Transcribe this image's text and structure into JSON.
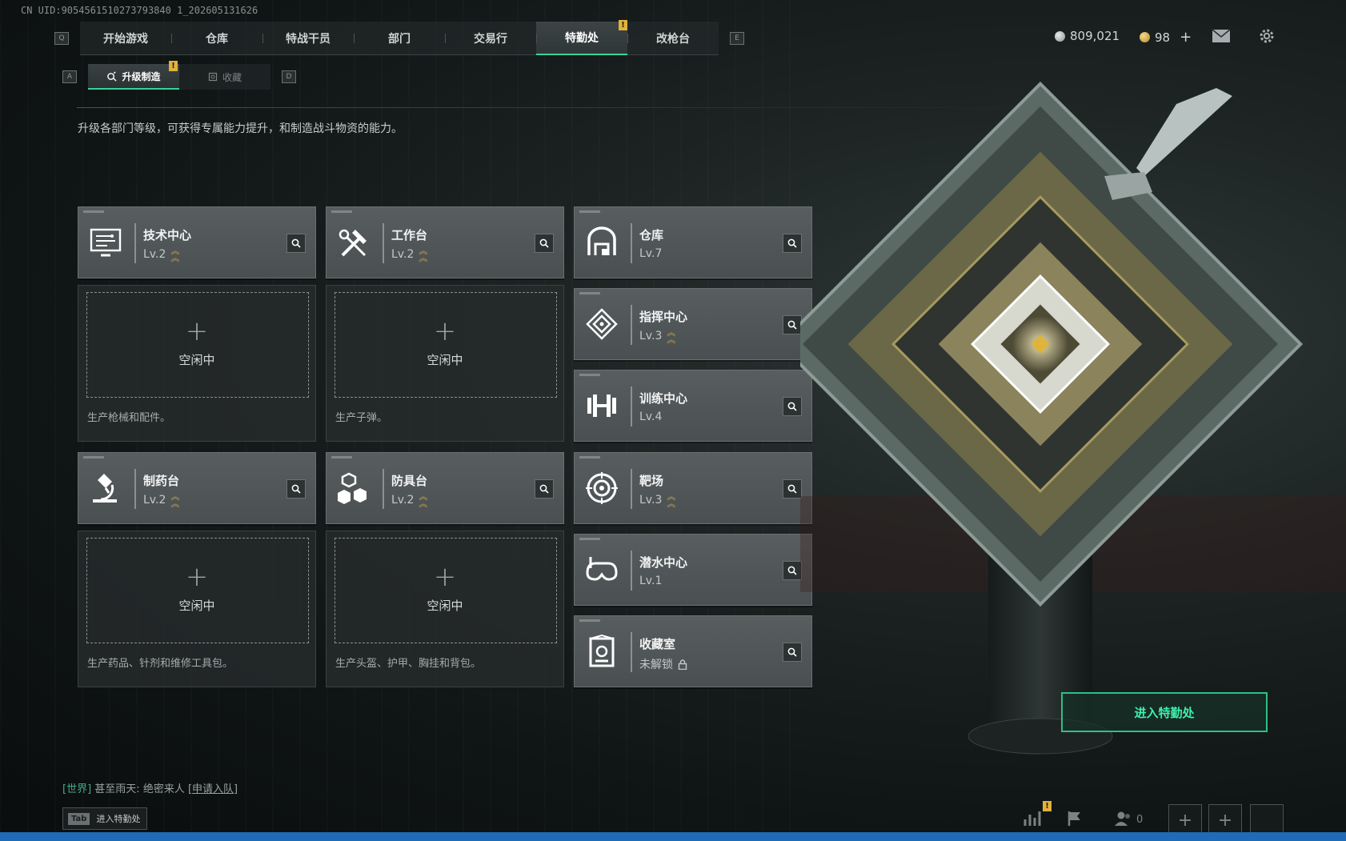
{
  "uid_text": "CN UID:9054561510273793840 1_202605131626",
  "nav": {
    "left_key": "Q",
    "right_key": "E",
    "tabs": [
      {
        "label": "开始游戏"
      },
      {
        "label": "仓库"
      },
      {
        "label": "特战干员"
      },
      {
        "label": "部门"
      },
      {
        "label": "交易行"
      },
      {
        "label": "特勤处",
        "active": true,
        "alert": "!"
      },
      {
        "label": "改枪台"
      }
    ]
  },
  "subnav": {
    "left_key": "A",
    "right_key": "D",
    "tabs": [
      {
        "label": "升级制造",
        "active": true,
        "alert": "!"
      },
      {
        "label": "收藏"
      }
    ]
  },
  "description": "升级各部门等级，可获得专属能力提升，和制造战斗物资的能力。",
  "resources": {
    "currency": "809,021",
    "premium": "98",
    "add": "+"
  },
  "departments": {
    "tech_center": {
      "name": "技术中心",
      "level": "Lv.2"
    },
    "workbench": {
      "name": "工作台",
      "level": "Lv.2"
    },
    "warehouse": {
      "name": "仓库",
      "level": "Lv.7"
    },
    "command_center": {
      "name": "指挥中心",
      "level": "Lv.3"
    },
    "training_center": {
      "name": "训练中心",
      "level": "Lv.4"
    },
    "pharmacy": {
      "name": "制药台",
      "level": "Lv.2"
    },
    "armor_bench": {
      "name": "防具台",
      "level": "Lv.2"
    },
    "shooting_range": {
      "name": "靶场",
      "level": "Lv.3"
    },
    "diving_center": {
      "name": "潜水中心",
      "level": "Lv.1"
    },
    "collection_room": {
      "name": "收藏室",
      "level": "未解锁"
    }
  },
  "idle_slots": {
    "idle_label": "空闲中",
    "plus": "+",
    "tech_center_desc": "生产枪械和配件。",
    "workbench_desc": "生产子弹。",
    "pharmacy_desc": "生产药品、针剂和维修工具包。",
    "armor_bench_desc": "生产头盔、护甲、胸挂和背包。"
  },
  "enter_button": "进入特勤处",
  "chat": {
    "channel": "[世界]",
    "user": "甚至雨天:",
    "message": "绝密来人",
    "action": "[申请入队]"
  },
  "tab_hint": {
    "key": "Tab",
    "label": "进入特勤处"
  },
  "bottom": {
    "friends_count": "0",
    "alert": "!",
    "add": "+"
  },
  "colors": {
    "accent": "#36d39a",
    "alert": "#e1b23b",
    "level_up_chevron": "#d7a743",
    "card_bg": "#525859"
  }
}
